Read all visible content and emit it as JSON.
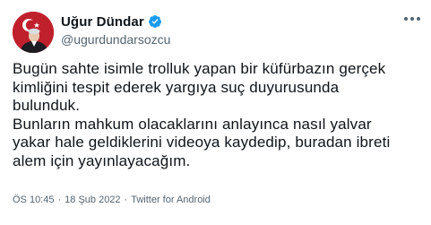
{
  "user": {
    "display_name": "Uğur Dündar",
    "handle": "@ugurdundarsozcu",
    "verified": true
  },
  "tweet": {
    "text": "Bugün sahte isimle trolluk yapan bir küfürbazın gerçek\nkimliğini tespit ederek yargıya suç duyurusunda\nbulunduk.\nBunların mahkum olacaklarını anlayınca nasıl yalvar\nyakar hale geldiklerini videoya kaydedip, buradan ibreti\nalem için yayınlayacağım."
  },
  "meta": {
    "time": "ÖS 10:45",
    "date": "18 Şub 2022",
    "source": "Twitter for Android",
    "separator": "·"
  },
  "icons": {
    "verified": "verified-badge-icon",
    "more": "more-dots-icon"
  },
  "colors": {
    "verified_blue": "#1d9bf0",
    "secondary_text": "#536471",
    "primary_text": "#0f1419",
    "avatar_red": "#c0202c"
  }
}
